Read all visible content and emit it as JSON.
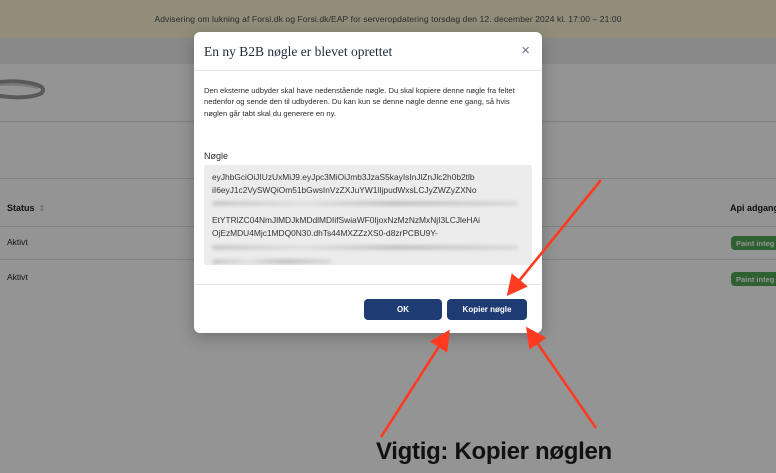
{
  "banner": {
    "text": "Advisering om lukning af Forsi.dk og Forsi.dk/EAP for serveropdatering torsdag den 12. december 2024 kl. 17:00 – 21:00"
  },
  "table": {
    "headers": {
      "status": "Status",
      "api": "Api adgang"
    },
    "rows": [
      {
        "status": "Aktivt",
        "api_badge": "Paint integ"
      },
      {
        "status": "Aktivt",
        "api_badge": "Paint integ"
      }
    ]
  },
  "modal": {
    "title": "En ny B2B nøgle er blevet oprettet",
    "close_glyph": "×",
    "description": "Den eksterne udbyder skal have nedenstående nøgle. Du skal kopiere denne nøgle fra feltet nedenfor og sende den til udbyderen. Du kan kun se denne nøgle denne ene gang, så hvis nøglen går tabt skal du generere en ny.",
    "key_label": "Nøgle",
    "key_lines": [
      "eyJhbGciOiJIUzUxMiJ9.eyJpc3MiOiJmb3JzaS5kayIsInJlZnJlc2h0b2tlb",
      "iI6eyJ1c2VySWQiOm51bGwsInVzZXJuYW1lIjpudWxsLCJyZWZyZXNo",
      "EtYTRlZC04NmJlMDJkMDdlMDIifSwiaWF0IjoxNzMzNzMxNjI3LCJleHAi",
      "OjEzMDU4Mjc1MDQ0N30.dhTs44MXZZzXS0-d8zrPCBU9Y-"
    ],
    "ok_label": "OK",
    "copy_label": "Kopier nøgle"
  },
  "annotation": {
    "callout": "Vigtig: Kopier nøglen",
    "color": "#ff3b1f"
  }
}
